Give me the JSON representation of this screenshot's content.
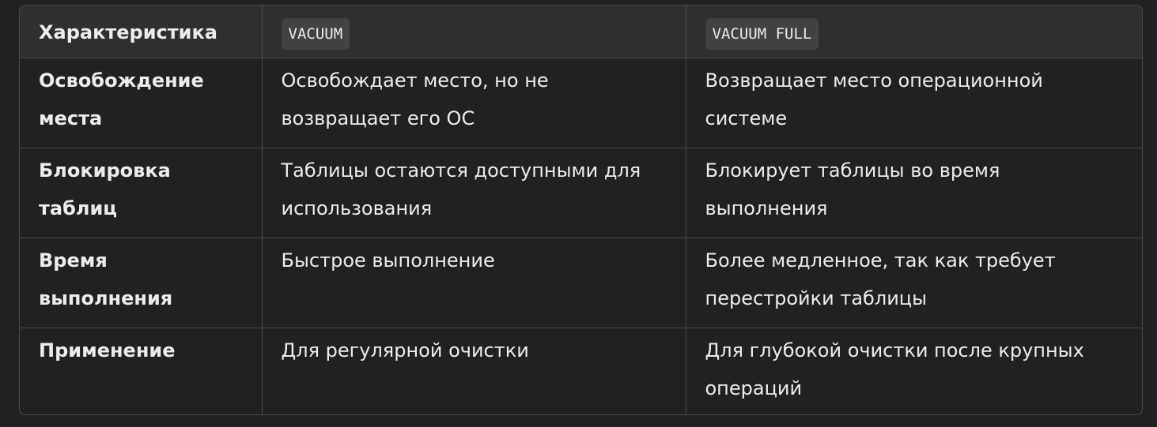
{
  "table": {
    "headers": [
      "Характеристика",
      "VACUUM",
      "VACUUM FULL"
    ],
    "rows": [
      [
        "Освобождение места",
        "Освобождает место, но не возвращает его ОС",
        "Возвращает место операционной системе"
      ],
      [
        "Блокировка таблиц",
        "Таблицы остаются доступными для использования",
        "Блокирует таблицы во время выполнения"
      ],
      [
        "Время выполнения",
        "Быстрое выполнение",
        "Более медленное, так как требует перестройки таблицы"
      ],
      [
        "Применение",
        "Для регулярной очистки",
        "Для глубокой очистки после крупных операций"
      ]
    ]
  }
}
